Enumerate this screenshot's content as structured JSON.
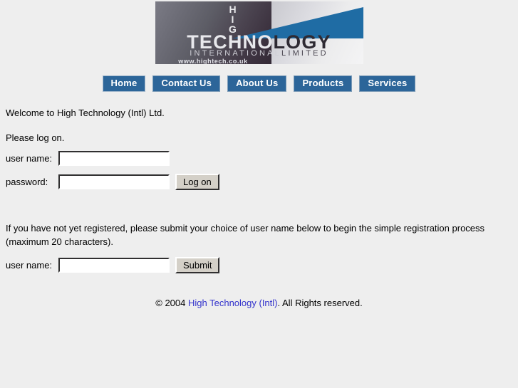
{
  "logo": {
    "hig_lines": [
      "H",
      "I",
      "G"
    ],
    "technology_light": "TECHNO",
    "technology_dark": "LOGY",
    "international_light": "INTERNATIONAL",
    "international_dark": "LIMITED",
    "url": "www.hightech.co.uk",
    "blue": "#1f6ca4"
  },
  "nav": {
    "items": [
      {
        "label": "Home"
      },
      {
        "label": "Contact Us"
      },
      {
        "label": "About Us"
      },
      {
        "label": "Products"
      },
      {
        "label": "Services"
      }
    ],
    "button_color": "#2c6599"
  },
  "main": {
    "welcome": "Welcome to High Technology (Intl) Ltd.",
    "please_log_on": "Please log on.",
    "login": {
      "username_label": "user name:",
      "username_value": "",
      "password_label": "password:",
      "password_value": "",
      "submit_label": "Log on"
    },
    "register": {
      "intro": "If you have not yet registered, please submit your choice of user name below to begin the simple registration process (maximum 20 characters).",
      "username_label": "user name:",
      "username_value": "",
      "submit_label": "Submit"
    }
  },
  "footer": {
    "prefix": "© 2004 ",
    "link": "High Technology (Intl)",
    "suffix": ". All Rights reserved.",
    "link_color": "#3333cc"
  }
}
